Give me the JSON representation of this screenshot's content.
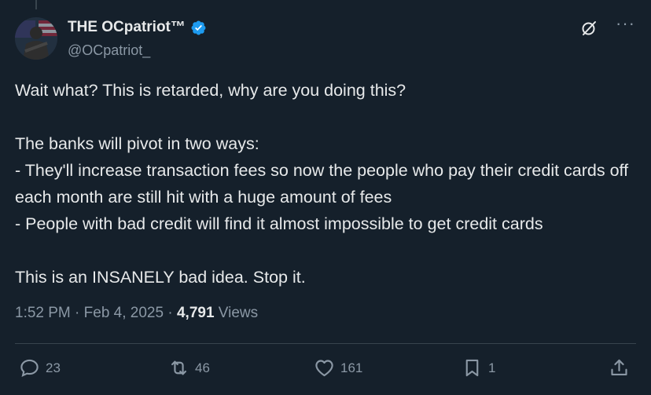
{
  "author": {
    "display_name": "THE OCpatriot™",
    "handle": "@OCpatriot_"
  },
  "tweet": {
    "text": "Wait what? This is retarded, why are you doing this?\n\nThe banks will pivot in two ways:\n- They'll increase transaction fees so now the people who pay their credit cards off each month are still hit with a huge amount of fees\n- People with bad credit will find it almost impossible to get credit cards\n\nThis is an INSANELY bad idea. Stop it.",
    "time": "1:52 PM",
    "separator": "·",
    "date": "Feb 4, 2025",
    "views_count": "4,791",
    "views_label": "Views"
  },
  "actions": {
    "replies": "23",
    "reposts": "46",
    "likes": "161",
    "bookmarks": "1"
  },
  "icons": {
    "verified": "verified-badge-icon",
    "grok": "grok-icon",
    "more": "more-icon",
    "reply": "reply-icon",
    "repost": "repost-icon",
    "like": "like-icon",
    "bookmark": "bookmark-icon",
    "share": "share-icon"
  },
  "colors": {
    "background": "#15202b",
    "text": "#e7e9ea",
    "secondary": "#8b98a5",
    "divider": "#38444d",
    "verified": "#1d9bf0"
  }
}
